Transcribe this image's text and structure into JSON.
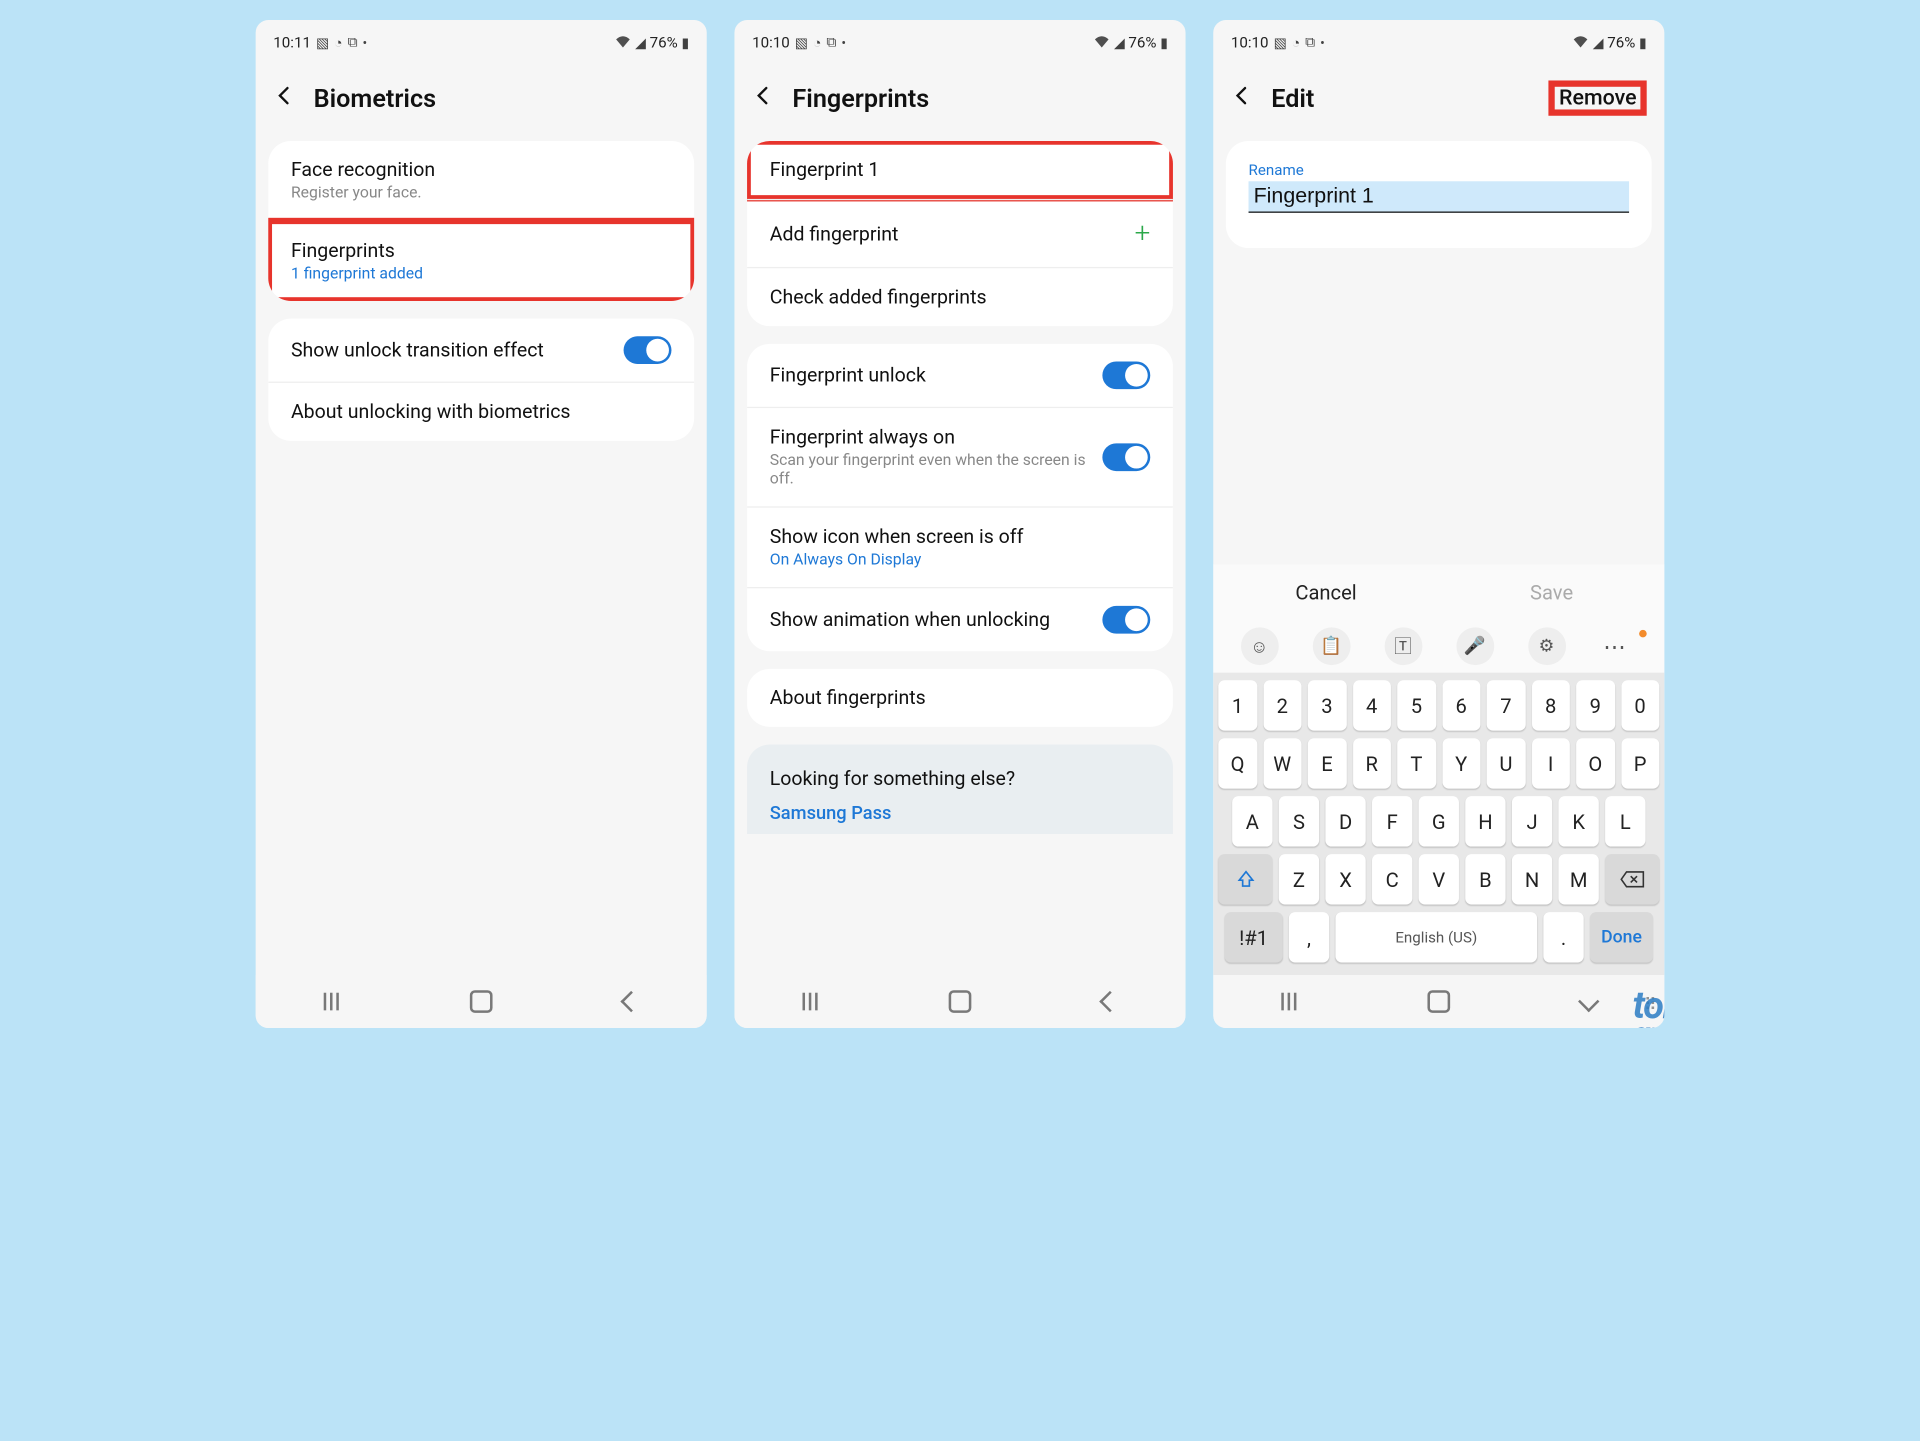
{
  "statusbar": {
    "time1": "10:11",
    "time2": "10:10",
    "time3": "10:10",
    "battery": "76%"
  },
  "screen1": {
    "title": "Biometrics",
    "face_label": "Face recognition",
    "face_sub": "Register your face.",
    "fp_label": "Fingerprints",
    "fp_sub": "1 fingerprint added",
    "transition_label": "Show unlock transition effect",
    "about_label": "About unlocking with biometrics"
  },
  "screen2": {
    "title": "Fingerprints",
    "fp1": "Fingerprint 1",
    "add": "Add fingerprint",
    "check": "Check added fingerprints",
    "unlock": "Fingerprint unlock",
    "always": "Fingerprint always on",
    "always_sub": "Scan your fingerprint even when the screen is off.",
    "icon": "Show icon when screen is off",
    "icon_sub": "On Always On Display",
    "anim": "Show animation when unlocking",
    "about": "About fingerprints",
    "looking": "Looking for something else?",
    "pass_link": "Samsung Pass"
  },
  "screen3": {
    "title": "Edit",
    "remove": "Remove",
    "rename_label": "Rename",
    "rename_value": "Fingerprint 1",
    "cancel": "Cancel",
    "save": "Save",
    "space_label": "English (US)",
    "sym_key": "!#1",
    "done": "Done"
  },
  "keys": {
    "row1": [
      "1",
      "2",
      "3",
      "4",
      "5",
      "6",
      "7",
      "8",
      "9",
      "0"
    ],
    "row2": [
      "Q",
      "W",
      "E",
      "R",
      "T",
      "Y",
      "U",
      "I",
      "O",
      "P"
    ],
    "row3": [
      "A",
      "S",
      "D",
      "F",
      "G",
      "H",
      "J",
      "K",
      "L"
    ],
    "row4": [
      "Z",
      "X",
      "C",
      "V",
      "B",
      "N",
      "M"
    ]
  },
  "watermark": {
    "top": "tom's",
    "bottom": "guide"
  }
}
